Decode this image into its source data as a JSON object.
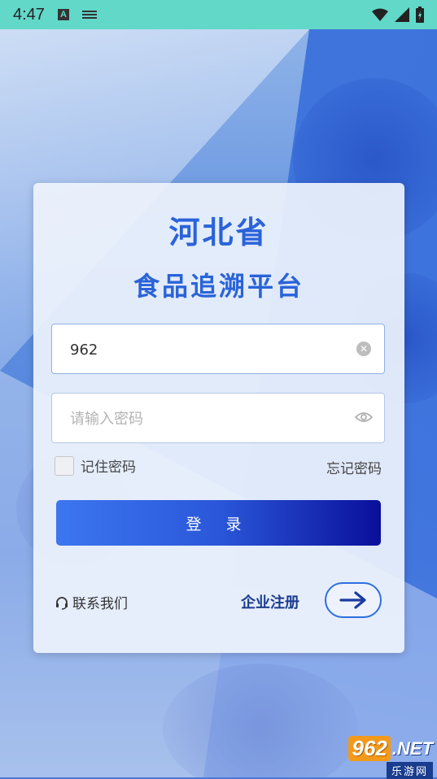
{
  "status_bar": {
    "time": "4:47",
    "a_badge": "A"
  },
  "title": {
    "line1": "河北省",
    "line2": "食品追溯平台"
  },
  "form": {
    "username_value": "962",
    "password_placeholder": "请输入密码",
    "remember_label": "记住密码",
    "forgot_label": "忘记密码",
    "login_label": "登 录"
  },
  "footer": {
    "contact_label": "联系我们",
    "register_label": "企业注册"
  },
  "watermark": {
    "num": "962",
    "net": ".NET",
    "sub": "乐游网"
  },
  "colors": {
    "accent": "#2a63d9",
    "status_bar": "#62d8c9"
  }
}
